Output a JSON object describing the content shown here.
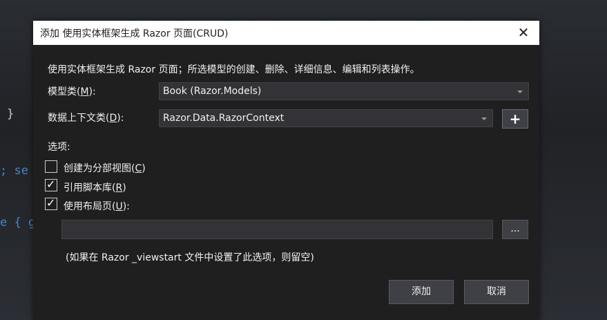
{
  "background": {
    "code_fragments": [
      "}",
      "; se",
      "e { g"
    ]
  },
  "dialog": {
    "title": "添加 使用实体框架生成 Razor 页面(CRUD)",
    "close_glyph": "✕",
    "description": "使用实体框架生成 Razor 页面；所选模型的创建、删除、详细信息、编辑和列表操作。",
    "model_class": {
      "label_pre": "模型类(",
      "label_key": "M",
      "label_post": "):",
      "value": "Book (Razor.Models)"
    },
    "data_context": {
      "label_pre": "数据上下文类(",
      "label_key": "D",
      "label_post": "):",
      "value": "Razor.Data.RazorContext",
      "add_glyph": "+"
    },
    "options_label": "选项:",
    "options": {
      "partial_view": {
        "label_pre": "创建为分部视图(",
        "label_key": "C",
        "label_post": ")",
        "checked": false
      },
      "script_libs": {
        "label_pre": "引用脚本库(",
        "label_key": "R",
        "label_post": ")",
        "checked": true
      },
      "use_layout": {
        "label_pre": "使用布局页(",
        "label_key": "U",
        "label_post": "):",
        "checked": true
      }
    },
    "layout_path": {
      "value": "",
      "browse_label": "..."
    },
    "note": "(如果在 Razor _viewstart 文件中设置了此选项，则留空)",
    "buttons": {
      "add": "添加",
      "cancel": "取消"
    },
    "check_glyph": "✓"
  }
}
